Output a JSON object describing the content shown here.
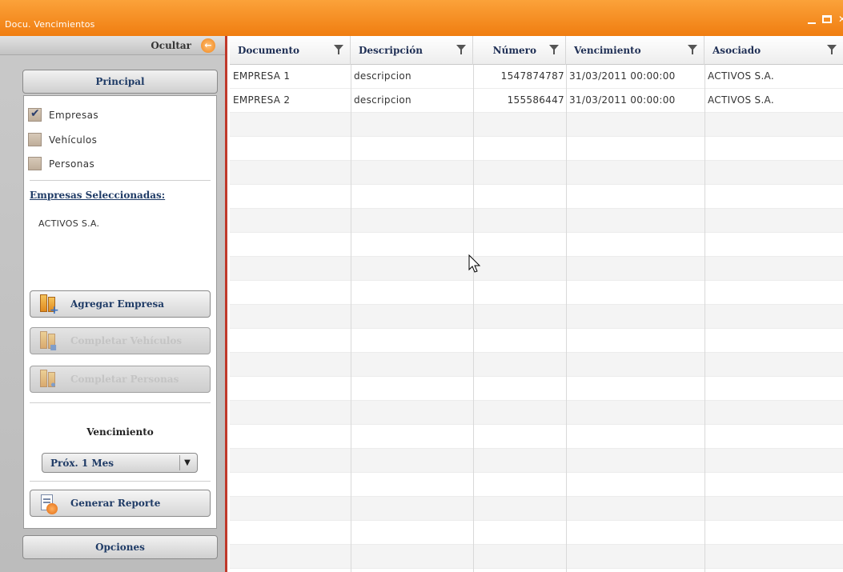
{
  "window": {
    "title": "Docu. Vencimientos"
  },
  "left_panel": {
    "hide_label": "Ocultar",
    "principal_label": "Principal",
    "checkboxes": [
      {
        "label": "Empresas",
        "checked": true
      },
      {
        "label": "Vehículos",
        "checked": false
      },
      {
        "label": "Personas",
        "checked": false
      }
    ],
    "selected_title": "Empresas Seleccionadas:",
    "selected_items": [
      "ACTIVOS S.A."
    ],
    "buttons": {
      "add_company": "Agregar Empresa",
      "complete_vehicles": "Completar Vehículos",
      "complete_people": "Completar Personas",
      "generate_report": "Generar Reporte"
    },
    "vencimiento_label": "Vencimiento",
    "vencimiento_value": "Próx. 1 Mes",
    "options_label": "Opciones"
  },
  "grid": {
    "columns": [
      "Documento",
      "Descripción",
      "Número",
      "Vencimiento",
      "Asociado"
    ],
    "rows": [
      [
        "EMPRESA 1",
        "descripcion",
        "1547874787",
        "31/03/2011 00:00:00",
        "ACTIVOS S.A."
      ],
      [
        "EMPRESA 2",
        "descripcion",
        "155586447",
        "31/03/2011 00:00:00",
        "ACTIVOS S.A."
      ]
    ]
  },
  "colors": {
    "accent": "#f28a1e",
    "divider": "#c0392b",
    "header_text": "#1f2f55"
  }
}
